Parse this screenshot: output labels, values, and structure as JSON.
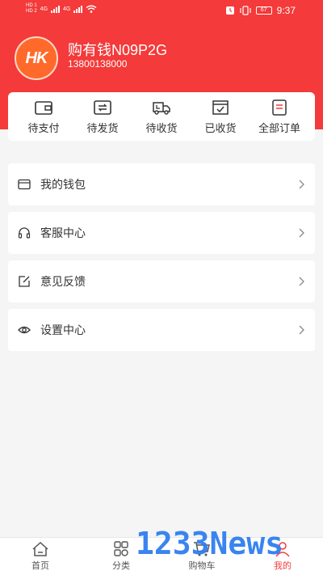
{
  "status_bar": {
    "sim1": "HD 1",
    "sim2": "HD 2",
    "net1": "4G",
    "net2": "4G",
    "battery": "67",
    "time": "9:37"
  },
  "profile": {
    "avatar_text": "HK",
    "name": "购有钱N09P2G",
    "phone": "13800138000"
  },
  "orders": [
    {
      "label": "待支付",
      "icon": "wallet-icon"
    },
    {
      "label": "待发货",
      "icon": "send-box-icon"
    },
    {
      "label": "待收货",
      "icon": "truck-icon"
    },
    {
      "label": "已收货",
      "icon": "received-box-icon"
    },
    {
      "label": "全部订单",
      "icon": "order-list-icon"
    }
  ],
  "menu": [
    {
      "label": "我的钱包",
      "icon": "card-icon"
    },
    {
      "label": "客服中心",
      "icon": "headset-icon"
    },
    {
      "label": "意见反馈",
      "icon": "edit-icon"
    },
    {
      "label": "设置中心",
      "icon": "eye-icon"
    }
  ],
  "tabbar": [
    {
      "label": "首页",
      "icon": "home-icon",
      "active": false
    },
    {
      "label": "分类",
      "icon": "grid-icon",
      "active": false
    },
    {
      "label": "购物车",
      "icon": "cart-icon",
      "active": false
    },
    {
      "label": "我的",
      "icon": "user-icon",
      "active": true
    }
  ],
  "watermark": "1233News",
  "colors": {
    "accent": "#f43a3a",
    "background": "#f5f5f5",
    "watermark": "#2f7ef0"
  }
}
